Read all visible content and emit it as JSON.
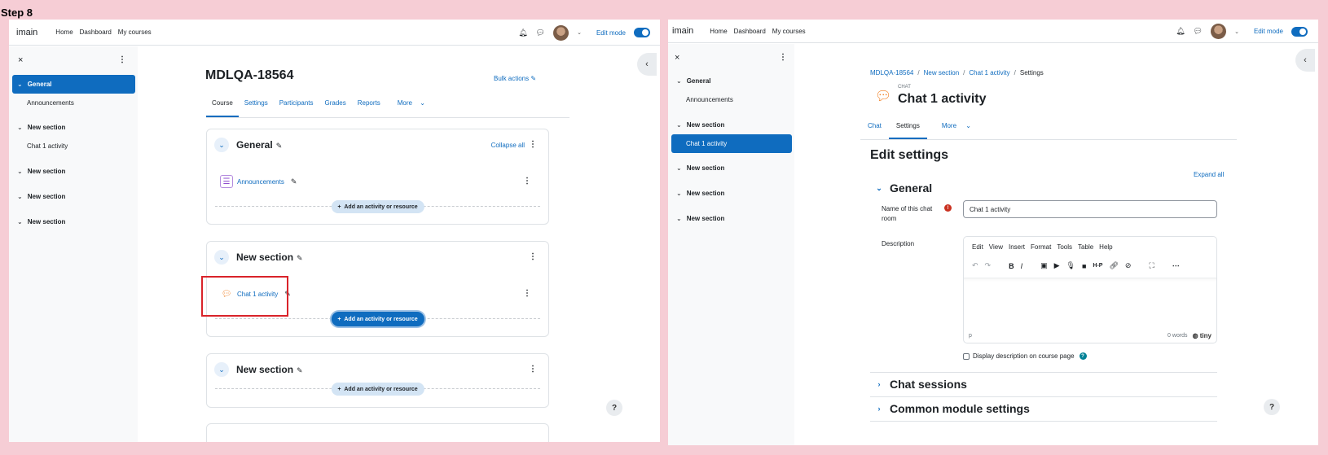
{
  "step_label": "Step 8",
  "colors": {
    "primary": "#0f6cbf",
    "highlight": "#d9232a",
    "chat_icon": "#f07a1a",
    "forum_icon": "#8f4ecf",
    "background": "#f6cdd5"
  },
  "left": {
    "nav": {
      "brand": "imain",
      "links": [
        "Home",
        "Dashboard",
        "My courses"
      ],
      "edit_mode": "Edit mode",
      "icons": [
        "bell-icon",
        "chat-bubble-icon",
        "avatar",
        "chevron-down-icon"
      ]
    },
    "drawer": {
      "close": "×",
      "sections": [
        {
          "label": "General",
          "active": true,
          "items": [
            "Announcements"
          ]
        },
        {
          "label": "New section",
          "active": false,
          "items": [
            "Chat 1 activity"
          ]
        },
        {
          "label": "New section",
          "active": false,
          "items": []
        },
        {
          "label": "New section",
          "active": false,
          "items": []
        },
        {
          "label": "New section",
          "active": false,
          "items": []
        }
      ]
    },
    "course": {
      "title": "MDLQA-18564",
      "bulk_actions": "Bulk actions",
      "tabs": [
        "Course",
        "Settings",
        "Participants",
        "Grades",
        "Reports",
        "More"
      ],
      "active_tab": "Course",
      "collapse_all": "Collapse all",
      "sections": [
        {
          "title": "General",
          "activity": "Announcements",
          "activity_type": "forum",
          "add_label": "Add an activity or resource"
        },
        {
          "title": "New section",
          "activity": "Chat 1 activity",
          "activity_type": "chat",
          "add_label": "Add an activity or resource"
        },
        {
          "title": "New section",
          "activity": "",
          "add_label": "Add an activity or resource"
        }
      ],
      "help": "?"
    }
  },
  "right": {
    "nav": {
      "brand": "imain",
      "links": [
        "Home",
        "Dashboard",
        "My courses"
      ],
      "edit_mode": "Edit mode"
    },
    "drawer": {
      "sections": [
        "General",
        "New section",
        "New section",
        "New section",
        "New section"
      ],
      "items": [
        "Announcements",
        "Chat 1 activity"
      ]
    },
    "breadcrumb": [
      "MDLQA-18564",
      "New section",
      "Chat 1 activity",
      "Settings"
    ],
    "module_type": "CHAT",
    "activity_title": "Chat 1 activity",
    "tabs": [
      "Chat",
      "Settings",
      "More"
    ],
    "active_tab": "Settings",
    "page_heading": "Edit settings",
    "expand_all": "Expand all",
    "general_heading": "General",
    "name_label": "Name of this chat room",
    "name_value": "Chat 1 activity",
    "description_label": "Description",
    "editor": {
      "menus": [
        "Edit",
        "View",
        "Insert",
        "Format",
        "Tools",
        "Table",
        "Help"
      ],
      "path": "p",
      "words": "0 words",
      "brand": "tiny"
    },
    "display_description": "Display description on course page",
    "chat_sessions": "Chat sessions",
    "common_module": "Common module settings",
    "help": "?"
  }
}
